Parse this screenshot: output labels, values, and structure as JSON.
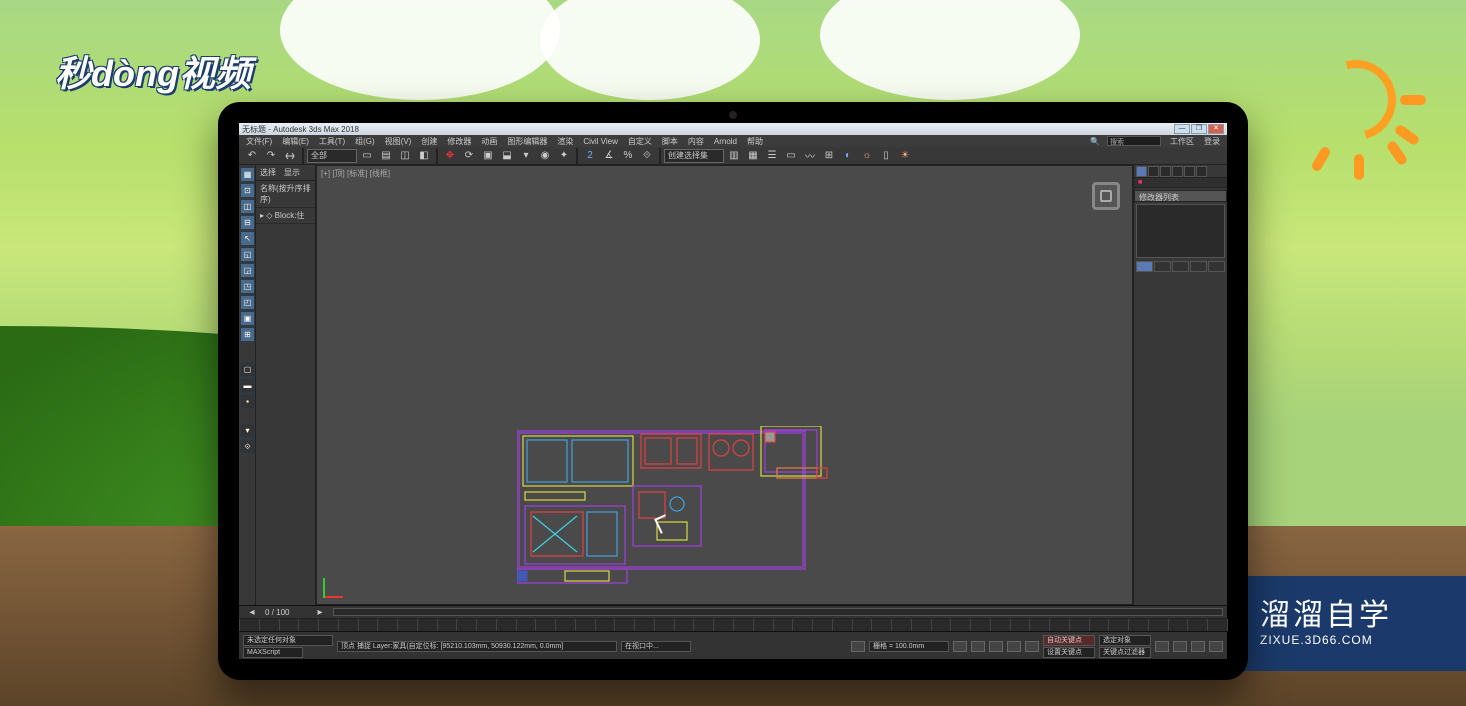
{
  "overlays": {
    "brand1": "秒dòng视频",
    "brand2_cn": "溜溜自学",
    "brand2_url": "ZIXUE.3D66.COM"
  },
  "window": {
    "title": "无标题 - Autodesk 3ds Max 2018",
    "controls": {
      "min": "—",
      "max": "❐",
      "close": "✕"
    }
  },
  "menus": {
    "file": "文件(F)",
    "edit": "编辑(E)",
    "tools": "工具(T)",
    "group": "组(G)",
    "views": "视图(V)",
    "create": "创建",
    "modify": "修改器",
    "animation": "动画",
    "graph": "图形编辑器",
    "render": "渲染",
    "civil": "Civil View",
    "custom": "自定义",
    "script": "脚本",
    "content": "内容",
    "arnold": "Arnold",
    "help": "帮助"
  },
  "workspace": {
    "search_placeholder": "搜索",
    "ws_label": "工作区",
    "login": "登录"
  },
  "toolbar": {
    "dropdown": "全部",
    "create": "创建选择集"
  },
  "left_tabs": {
    "select": "选择",
    "display": "显示"
  },
  "scene": {
    "name_header": "名称(按升序排序)",
    "item1": "Block:住"
  },
  "viewport": {
    "label": "[+] [顶] [标准] [线框]"
  },
  "right": {
    "header": "修改器列表"
  },
  "time": {
    "range": "0 / 100"
  },
  "status": {
    "none": "未选定任何对象",
    "script": "MAXScript",
    "prompt": "顶点 捕捉 Layer:家具(自定位标: [95210.103mm, 50930.122mm, 0.0mm]",
    "grid": "栅格 = 100.0mm",
    "autokey": "自动关键点",
    "filter": "选定对象",
    "setkey": "设置关键点",
    "keyfilter": "关键点过滤器",
    "lock": "在视口中..."
  }
}
